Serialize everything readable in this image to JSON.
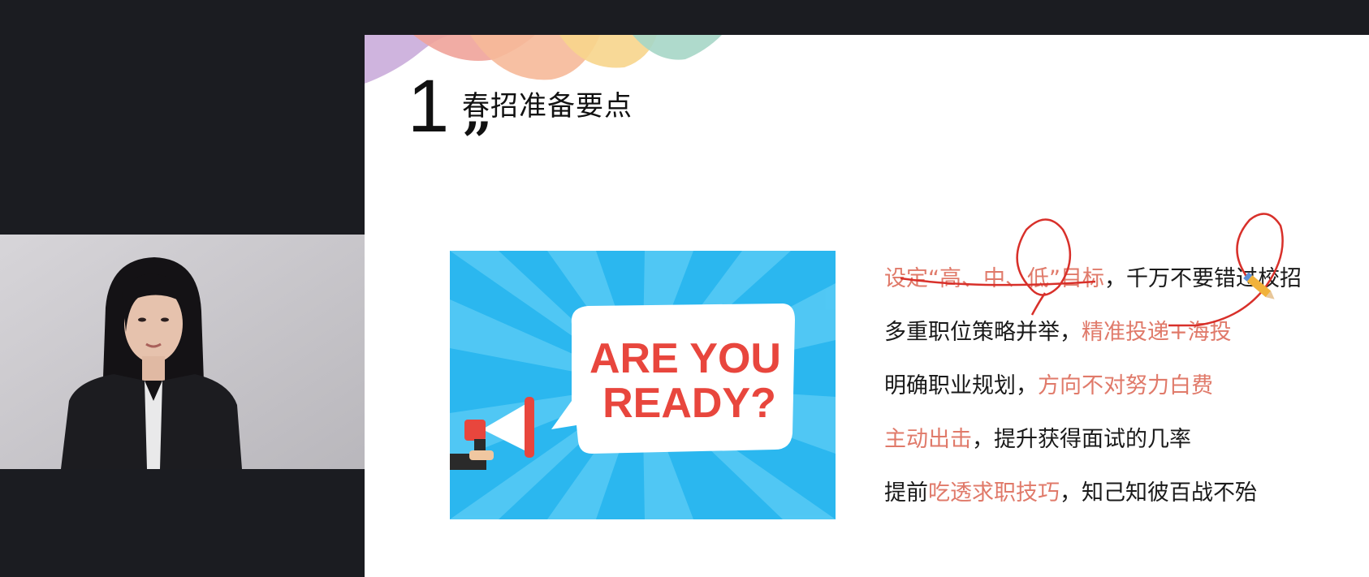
{
  "slide": {
    "number": "1",
    "title": "春招准备要点",
    "quote_mark": "”",
    "banner": {
      "line1": "ARE YOU",
      "line2": "READY?"
    },
    "bullets": [
      {
        "highlight": "设定“高、中、低”目标",
        "rest": "，千万不要错过校招"
      },
      {
        "prefix": "多重职位策略并举，",
        "highlight": "精准投递+海投"
      },
      {
        "prefix": "明确职业规划，",
        "highlight": "方向不对努力白费"
      },
      {
        "highlight": "主动出击",
        "rest": "，提升获得面试的几率"
      },
      {
        "prefix": "提前",
        "highlight": "吃透求职技巧",
        "rest": "，知己知彼百战不殆"
      }
    ]
  },
  "colors": {
    "background": "#1b1c21",
    "highlight": "#e07a6a",
    "annotation": "#d8302a",
    "banner_blue": "#2bb7ef",
    "banner_text": "#e8463d"
  },
  "icons": [
    "megaphone-icon",
    "pencil-cursor-icon"
  ]
}
